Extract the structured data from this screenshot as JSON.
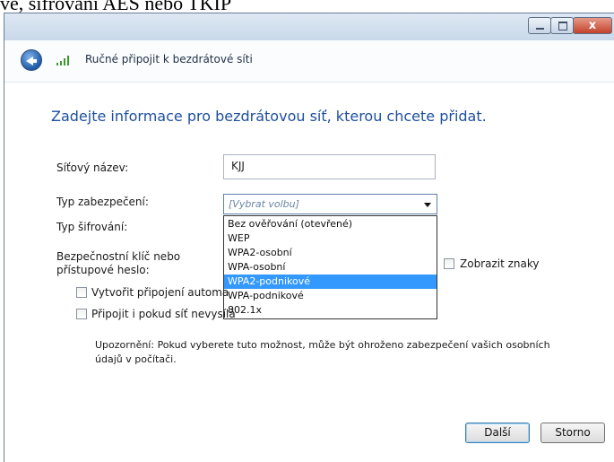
{
  "caption": "ve, šifrování AES nebo TKIP",
  "window": {
    "close_glyph": "x"
  },
  "nav": {
    "title": "Ručné připojit k bezdrátové síti",
    "back_icon": "back-arrow-icon",
    "network_icon": "wireless-signal-icon"
  },
  "heading": "Zadejte informace pro bezdrátovou síť, kterou chcete přidat.",
  "form": {
    "ssid_label": "Síťový název:",
    "ssid_value": "KJJ",
    "security_label": "Typ zabezpečení:",
    "security_value": "[Vybrat volbu]",
    "security_options": [
      "Bez ověřování (otevřené)",
      "WEP",
      "WPA2-osobní",
      "WPA-osobní",
      "WPA2-podnikové",
      "WPA-podnikové",
      "802.1x"
    ],
    "security_selected": "WPA2-podnikové",
    "encryption_label": "Typ šifrování:",
    "key_label_line1": "Bezpečnostní klíč nebo",
    "key_label_line2": "přístupové heslo:",
    "show_chars_label": "Zobrazit znaky",
    "auto_connect_label": "Vytvořit připojení automa",
    "connect_hidden_label": "Připojit i pokud síť nevysílá",
    "warning_line1": "Upozornění: Pokud vyberete tuto možnost, může být ohroženo zabezpečení vašich osobních",
    "warning_line2": "údajů v počítači."
  },
  "buttons": {
    "next": "Další",
    "cancel": "Storno"
  },
  "colors": {
    "heading": "#1e4f9c",
    "selection": "#3399ff"
  }
}
